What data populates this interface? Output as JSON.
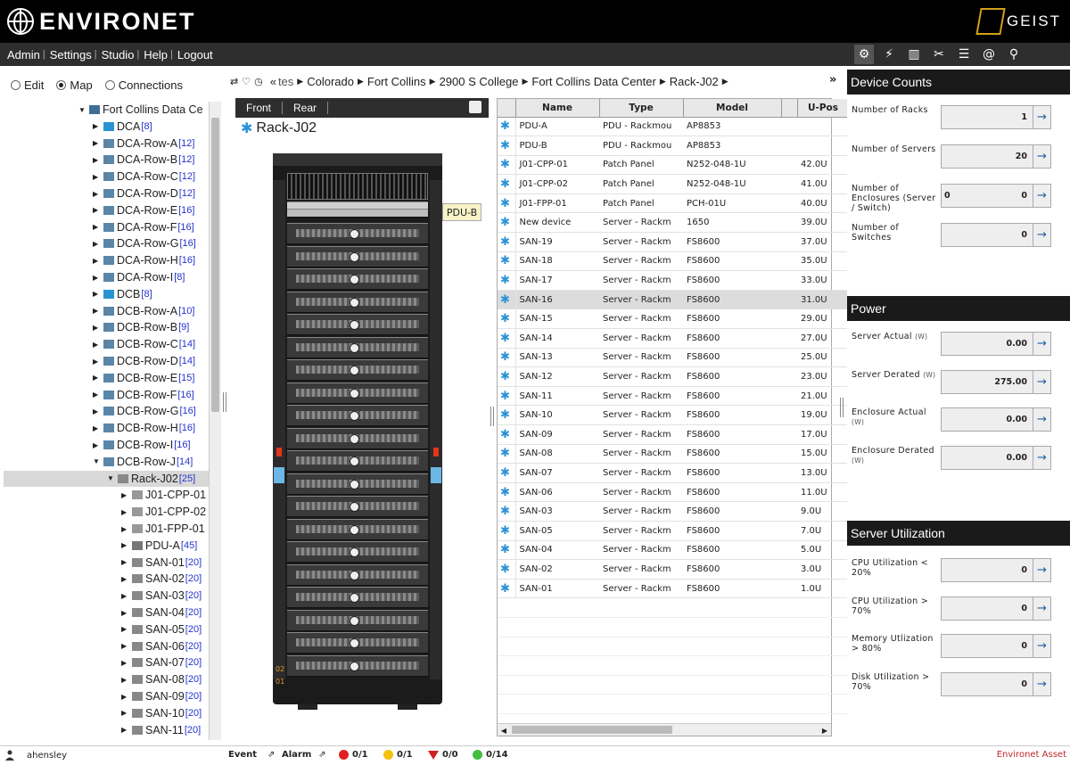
{
  "app": {
    "brand": "ENVIRONET",
    "partner_brand": "GEIST"
  },
  "menu": [
    "Admin",
    "Settings",
    "Studio",
    "Help",
    "Logout"
  ],
  "toolstrip": [
    "gear-icon",
    "bolt-icon",
    "trash-icon",
    "tools-icon",
    "list-icon",
    "at-icon",
    "search-icon"
  ],
  "modes": [
    {
      "label": "Edit",
      "selected": false
    },
    {
      "label": "Map",
      "selected": true
    },
    {
      "label": "Connections",
      "selected": false
    }
  ],
  "breadcrumb": {
    "lead": "«",
    "first_truncated": "tes",
    "items": [
      "Colorado",
      "Fort Collins",
      "2900 S College",
      "Fort Collins Data Center",
      "Rack-J02"
    ],
    "more": "»"
  },
  "tree": [
    {
      "label": "Fort Collins Data Ce",
      "count": "",
      "expand": "▼"
    },
    {
      "label": "DCA",
      "count": "[8]",
      "expand": "▶"
    },
    {
      "label": "DCA-Row-A",
      "count": "[12]",
      "expand": "▶"
    },
    {
      "label": "DCA-Row-B",
      "count": "[12]",
      "expand": "▶"
    },
    {
      "label": "DCA-Row-C",
      "count": "[12]",
      "expand": "▶"
    },
    {
      "label": "DCA-Row-D",
      "count": "[12]",
      "expand": "▶"
    },
    {
      "label": "DCA-Row-E",
      "count": "[16]",
      "expand": "▶"
    },
    {
      "label": "DCA-Row-F",
      "count": "[16]",
      "expand": "▶"
    },
    {
      "label": "DCA-Row-G",
      "count": "[16]",
      "expand": "▶"
    },
    {
      "label": "DCA-Row-H",
      "count": "[16]",
      "expand": "▶"
    },
    {
      "label": "DCA-Row-I",
      "count": "[8]",
      "expand": "▶"
    },
    {
      "label": "DCB",
      "count": "[8]",
      "expand": "▶"
    },
    {
      "label": "DCB-Row-A",
      "count": "[10]",
      "expand": "▶"
    },
    {
      "label": "DCB-Row-B",
      "count": "[9]",
      "expand": "▶"
    },
    {
      "label": "DCB-Row-C",
      "count": "[14]",
      "expand": "▶"
    },
    {
      "label": "DCB-Row-D",
      "count": "[14]",
      "expand": "▶"
    },
    {
      "label": "DCB-Row-E",
      "count": "[15]",
      "expand": "▶"
    },
    {
      "label": "DCB-Row-F",
      "count": "[16]",
      "expand": "▶"
    },
    {
      "label": "DCB-Row-G",
      "count": "[16]",
      "expand": "▶"
    },
    {
      "label": "DCB-Row-H",
      "count": "[16]",
      "expand": "▶"
    },
    {
      "label": "DCB-Row-I",
      "count": "[16]",
      "expand": "▶"
    },
    {
      "label": "DCB-Row-J",
      "count": "[14]",
      "expand": "▼"
    },
    {
      "label": "Rack-J02",
      "count": "[25]",
      "expand": "▼",
      "selected": true
    },
    {
      "label": "J01-CPP-01",
      "count": "",
      "expand": "▶"
    },
    {
      "label": "J01-CPP-02",
      "count": "",
      "expand": "▶"
    },
    {
      "label": "J01-FPP-01",
      "count": "",
      "expand": "▶"
    },
    {
      "label": "PDU-A",
      "count": "[45]",
      "expand": "▶"
    },
    {
      "label": "SAN-01",
      "count": "[20]",
      "expand": "▶"
    },
    {
      "label": "SAN-02",
      "count": "[20]",
      "expand": "▶"
    },
    {
      "label": "SAN-03",
      "count": "[20]",
      "expand": "▶"
    },
    {
      "label": "SAN-04",
      "count": "[20]",
      "expand": "▶"
    },
    {
      "label": "SAN-05",
      "count": "[20]",
      "expand": "▶"
    },
    {
      "label": "SAN-06",
      "count": "[20]",
      "expand": "▶"
    },
    {
      "label": "SAN-07",
      "count": "[20]",
      "expand": "▶"
    },
    {
      "label": "SAN-08",
      "count": "[20]",
      "expand": "▶"
    },
    {
      "label": "SAN-09",
      "count": "[20]",
      "expand": "▶"
    },
    {
      "label": "SAN-10",
      "count": "[20]",
      "expand": "▶"
    },
    {
      "label": "SAN-11",
      "count": "[20]",
      "expand": "▶"
    }
  ],
  "rack_view": {
    "tabs": [
      "Front",
      "Rear"
    ],
    "active_tab": "Front",
    "title": "Rack-J02",
    "tooltip": "PDU-B",
    "side_labels": [
      "02",
      "01"
    ]
  },
  "grid": {
    "columns": [
      "Name",
      "Type",
      "Model",
      "U-Pos"
    ],
    "rows": [
      [
        "PDU-A",
        "PDU - Rackmou",
        "AP8853",
        ""
      ],
      [
        "PDU-B",
        "PDU - Rackmou",
        "AP8853",
        ""
      ],
      [
        "J01-CPP-01",
        "Patch Panel",
        "N252-048-1U",
        "42.0U"
      ],
      [
        "J01-CPP-02",
        "Patch Panel",
        "N252-048-1U",
        "41.0U"
      ],
      [
        "J01-FPP-01",
        "Patch Panel",
        "PCH-01U",
        "40.0U"
      ],
      [
        "New device",
        "Server - Rackm",
        "1650",
        "39.0U"
      ],
      [
        "SAN-19",
        "Server - Rackm",
        "FS8600",
        "37.0U"
      ],
      [
        "SAN-18",
        "Server - Rackm",
        "FS8600",
        "35.0U"
      ],
      [
        "SAN-17",
        "Server - Rackm",
        "FS8600",
        "33.0U"
      ],
      [
        "SAN-16",
        "Server - Rackm",
        "FS8600",
        "31.0U"
      ],
      [
        "SAN-15",
        "Server - Rackm",
        "FS8600",
        "29.0U"
      ],
      [
        "SAN-14",
        "Server - Rackm",
        "FS8600",
        "27.0U"
      ],
      [
        "SAN-13",
        "Server - Rackm",
        "FS8600",
        "25.0U"
      ],
      [
        "SAN-12",
        "Server - Rackm",
        "FS8600",
        "23.0U"
      ],
      [
        "SAN-11",
        "Server - Rackm",
        "FS8600",
        "21.0U"
      ],
      [
        "SAN-10",
        "Server - Rackm",
        "FS8600",
        "19.0U"
      ],
      [
        "SAN-09",
        "Server - Rackm",
        "FS8600",
        "17.0U"
      ],
      [
        "SAN-08",
        "Server - Rackm",
        "FS8600",
        "15.0U"
      ],
      [
        "SAN-07",
        "Server - Rackm",
        "FS8600",
        "13.0U"
      ],
      [
        "SAN-06",
        "Server - Rackm",
        "FS8600",
        "11.0U"
      ],
      [
        "SAN-03",
        "Server - Rackm",
        "FS8600",
        "9.0U"
      ],
      [
        "SAN-05",
        "Server - Rackm",
        "FS8600",
        "7.0U"
      ],
      [
        "SAN-04",
        "Server - Rackm",
        "FS8600",
        "5.0U"
      ],
      [
        "SAN-02",
        "Server - Rackm",
        "FS8600",
        "3.0U"
      ],
      [
        "SAN-01",
        "Server - Rackm",
        "FS8600",
        "1.0U"
      ]
    ],
    "selected_row": 9
  },
  "side": {
    "device_counts": {
      "title": "Device Counts",
      "items": [
        {
          "label": "Number of Racks",
          "unit": "",
          "value": "1"
        },
        {
          "label": "Number of Servers",
          "unit": "",
          "value": "20"
        },
        {
          "label": "Number of Enclosures (Server / Switch)",
          "unit": "",
          "value": "0",
          "value2": "0"
        },
        {
          "label": "Number of Switches",
          "unit": "",
          "value": "0"
        }
      ]
    },
    "power": {
      "title": "Power",
      "items": [
        {
          "label": "Server Actual",
          "unit": "(W)",
          "value": "0.00"
        },
        {
          "label": "Server Derated",
          "unit": "(W)",
          "value": "275.00"
        },
        {
          "label": "Enclosure Actual",
          "unit": "(W)",
          "value": "0.00"
        },
        {
          "label": "Enclosure Derated",
          "unit": "(W)",
          "value": "0.00"
        }
      ]
    },
    "utilization": {
      "title": "Server Utilization",
      "items": [
        {
          "label": "CPU Utilization < 20%",
          "unit": "",
          "value": "0"
        },
        {
          "label": "CPU Utilization > 70%",
          "unit": "",
          "value": "0"
        },
        {
          "label": "Memory Utlization > 80%",
          "unit": "",
          "value": "0"
        },
        {
          "label": "Disk Utilization > 70%",
          "unit": "",
          "value": "0"
        }
      ]
    }
  },
  "footer": {
    "user": "ahensley",
    "event_label": "Event",
    "alarm_label": "Alarm",
    "counters": [
      {
        "value": "0/1",
        "color": "#e02020"
      },
      {
        "value": "0/1",
        "color": "#f2c20c"
      },
      {
        "value": "0/0",
        "color": "#d02020"
      },
      {
        "value": "0/14",
        "color": "#3fbf3f"
      }
    ],
    "product": "Environet Asset"
  }
}
